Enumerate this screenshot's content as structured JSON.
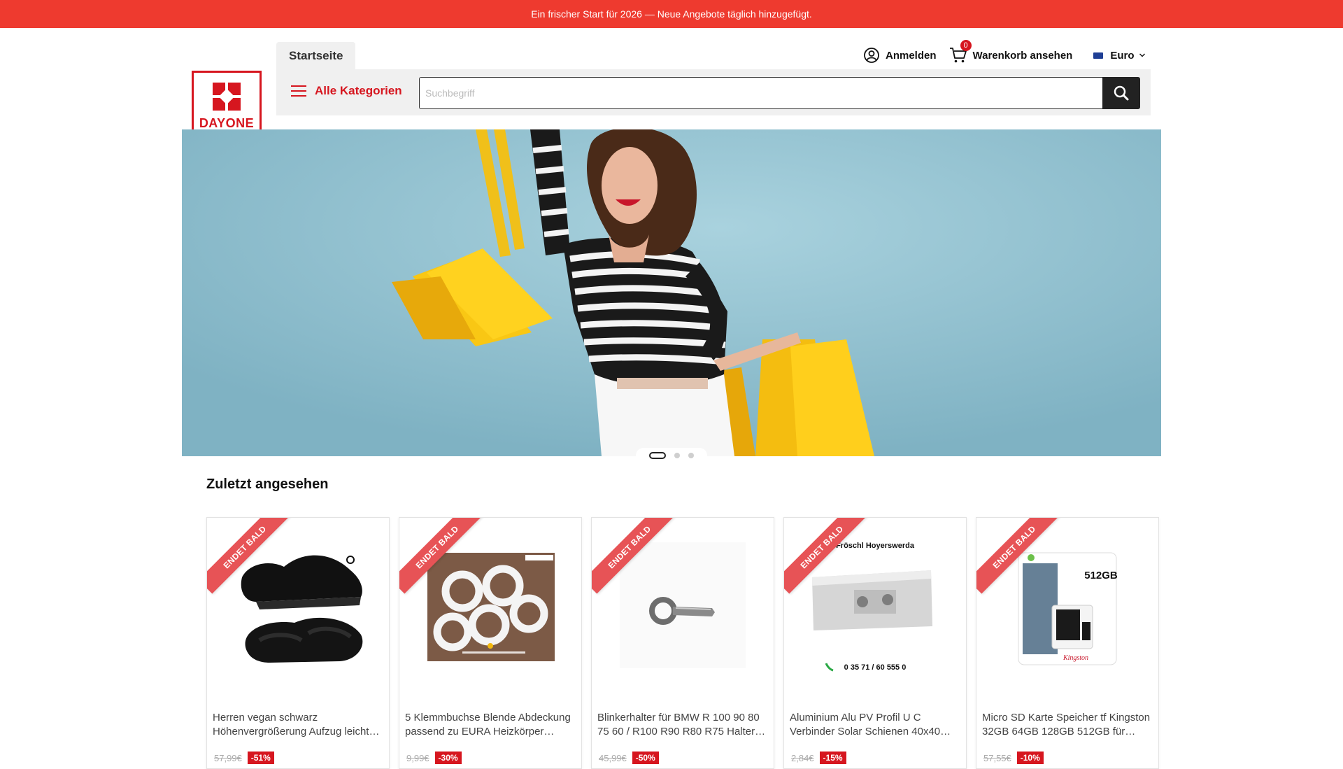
{
  "promo": {
    "text": "Ein frischer Start für 2026 — Neue Angebote täglich hinzugefügt."
  },
  "logo": {
    "text": "DAYONE"
  },
  "nav": {
    "home_tab": "Startseite",
    "categories": "Alle Kategorien"
  },
  "search": {
    "placeholder": "Suchbegriff",
    "value": ""
  },
  "user_nav": {
    "login": "Anmelden",
    "cart": "Warenkorb ansehen",
    "cart_count": "0",
    "currency": "Euro"
  },
  "hero": {
    "slides": 3,
    "active_slide": 1
  },
  "recently_viewed": {
    "title": "Zuletzt angesehen",
    "badge": "ENDET BALD",
    "products": [
      {
        "title": "Herren vegan schwarz Höhenvergrößerung Aufzug leicht…",
        "old_price": "57,99€",
        "discount": "-51%"
      },
      {
        "title": "5 Klemmbuchse Blende Abdeckung passend zu EURA Heizkörper…",
        "old_price": "9,99€",
        "discount": "-30%"
      },
      {
        "title": "Blinkerhalter für BMW R 100 90 80 75 60 / R100 R90 R80 R75 Halter…",
        "old_price": "45,99€",
        "discount": "-50%"
      },
      {
        "title": "Aluminium Alu PV Profil U C Verbinder Solar Schienen 40x40…",
        "old_price": "2,84€",
        "discount": "-15%",
        "image_text": {
          "brand": "Fröschl Hoyerswerda",
          "phone": "0 35 71 / 60 555 0"
        }
      },
      {
        "title": "Micro SD Karte Speicher tf Kingston 32GB 64GB 128GB 512GB für…",
        "old_price": "57,55€",
        "discount": "-10%",
        "image_text": {
          "capacity": "512GB",
          "brand": "Kingston"
        }
      }
    ]
  },
  "colors": {
    "brand_red": "#d6161f",
    "promo_bg": "#ee3a2f",
    "ribbon": "#e75356",
    "hero_bg": "#92c3d2",
    "search_button": "#222222"
  }
}
